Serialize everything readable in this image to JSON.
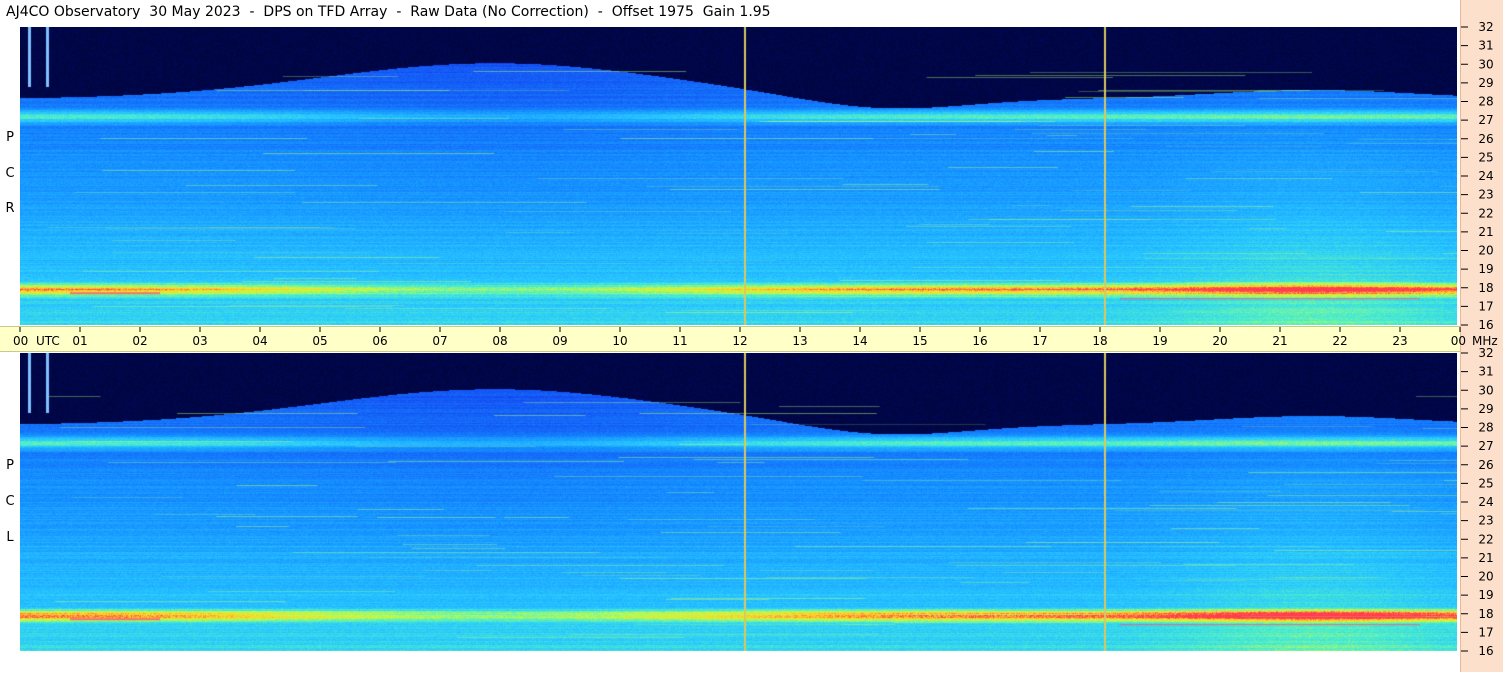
{
  "header": {
    "title": "AJ4CO Observatory  30 May 2023  -  DPS on TFD Array  -  Raw Data (No Correction)  -  Offset 1975  Gain 1.95"
  },
  "panels": {
    "top": {
      "polarization_letters": [
        "P",
        "C",
        "R"
      ]
    },
    "bottom": {
      "polarization_letters": [
        "P",
        "C",
        "L"
      ]
    }
  },
  "colors": {
    "dark_bg": "#000010",
    "spectrum_blue": "#1060f0",
    "marker_line": "#d8c860",
    "axis_bg": "#ffffc8",
    "freq_axis_bg": "#fde0cc"
  },
  "chart_data": {
    "type": "heatmap",
    "title": "AJ4CO Observatory  30 May 2023  -  DPS on TFD Array  -  Raw Data (No Correction)  -  Offset 1975  Gain 1.95",
    "x_unit": "UTC",
    "y_unit": "MHz",
    "x_ticks": [
      "00",
      "01",
      "02",
      "03",
      "04",
      "05",
      "06",
      "07",
      "08",
      "09",
      "10",
      "11",
      "12",
      "13",
      "14",
      "15",
      "16",
      "17",
      "18",
      "19",
      "20",
      "21",
      "22",
      "23",
      "00"
    ],
    "x_range": [
      0,
      24
    ],
    "y_ticks": [
      16,
      17,
      18,
      19,
      20,
      21,
      22,
      23,
      24,
      25,
      26,
      27,
      28,
      29,
      30,
      31,
      32
    ],
    "y_range": [
      16,
      32
    ],
    "marker_times_utc": [
      12.1,
      18.1
    ],
    "series": [
      {
        "name": "RCP",
        "panel": "top"
      },
      {
        "name": "LCP",
        "panel": "bottom"
      }
    ]
  }
}
